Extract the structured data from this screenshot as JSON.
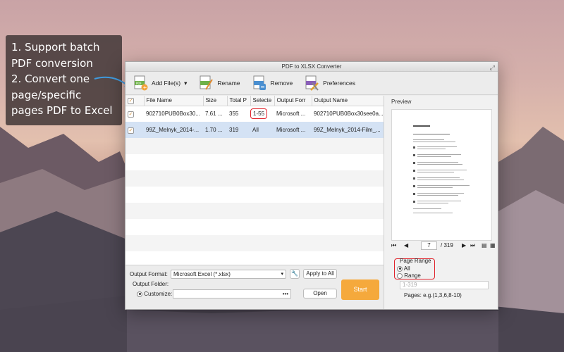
{
  "callout": {
    "lines": [
      "1. Support batch",
      "PDF conversion",
      "2. Convert one",
      "page/specific",
      "pages PDF to Excel"
    ]
  },
  "window": {
    "title": "PDF to XLSX Converter"
  },
  "toolbar": {
    "add_files": "Add File(s)",
    "rename": "Rename",
    "remove": "Remove",
    "preferences": "Preferences"
  },
  "table": {
    "headers": [
      "File Name",
      "Size",
      "Total P",
      "Selecte",
      "Output Forr",
      "Output Name"
    ],
    "rows": [
      {
        "checked": true,
        "name": "902710PUB0Box30...",
        "size": "7.61 ...",
        "total": "355",
        "selected": "1-55",
        "format": "Microsoft ...",
        "output": "902710PUB0Box30see0a..."
      },
      {
        "checked": true,
        "name": "99Z_Melnyk_2014-...",
        "size": "1.70 ...",
        "total": "319",
        "selected": "All",
        "format": "Microsoft ...",
        "output": "99Z_Melnyk_2014-Film_..."
      }
    ]
  },
  "bottom": {
    "output_format_label": "Output Format:",
    "output_format_value": "Microsoft Excel (*.xlsx)",
    "apply_to_all": "Apply to All",
    "output_folder_label": "Output Folder:",
    "customize_label": "Customize:",
    "folder_browse": "•••",
    "open_label": "Open",
    "start_label": "Start"
  },
  "preview": {
    "title": "Preview",
    "current_page": "7",
    "total_pages": "/ 319",
    "page_range_label": "Page Range",
    "option_all": "All",
    "option_range": "Range",
    "range_placeholder": "1-319",
    "pages_hint": "Pages: e.g.(1,3,6,8-10)"
  },
  "colors": {
    "start_button": "#f5a93c",
    "highlight": "#e0222a",
    "selected_row": "#d4e2f4"
  }
}
